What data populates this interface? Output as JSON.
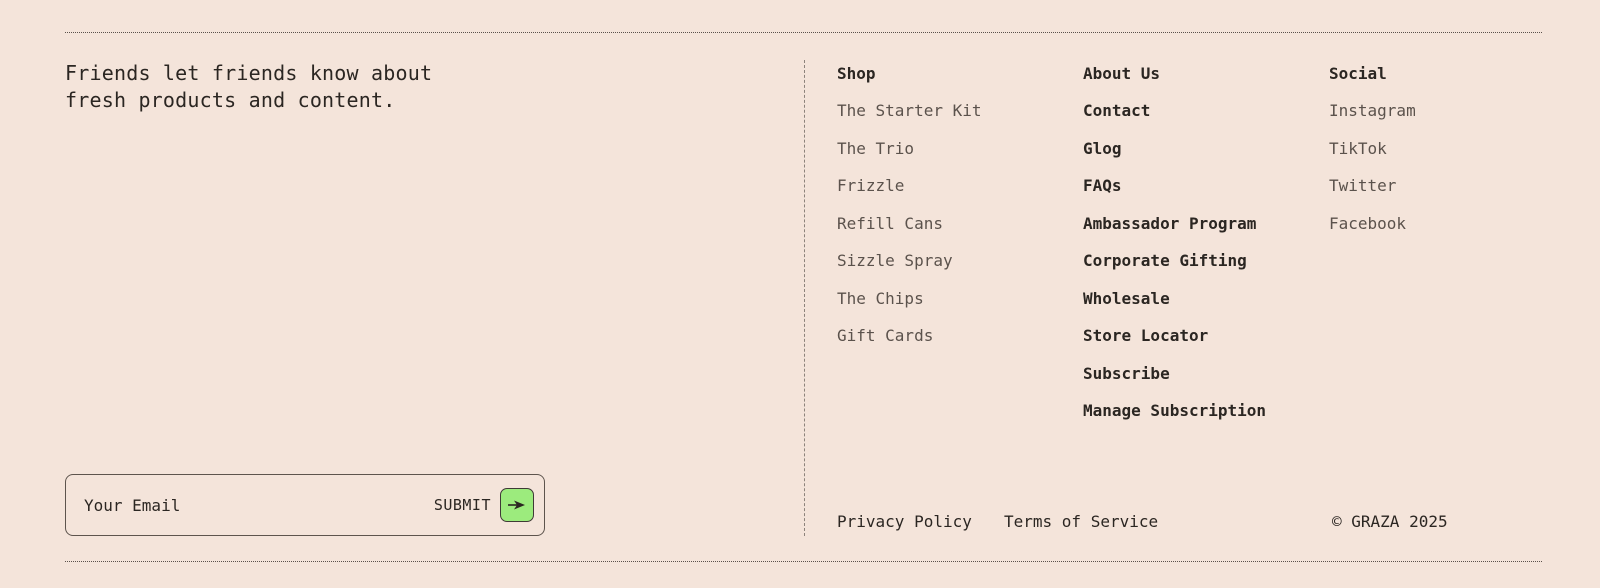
{
  "tagline": {
    "line1": "Friends let friends know about",
    "line2": "fresh products and content."
  },
  "subscribe": {
    "placeholder": "Your Email",
    "submit_label": "SUBMIT",
    "button_color": "#9ceb7d"
  },
  "shop": {
    "heading": "Shop",
    "items": [
      "The Starter Kit",
      "The Trio",
      "Frizzle",
      "Refill Cans",
      "Sizzle Spray",
      "The Chips",
      "Gift Cards"
    ]
  },
  "about": {
    "heading": "About Us",
    "items": [
      "Contact",
      "Glog",
      "FAQs",
      "Ambassador Program",
      "Corporate Gifting",
      "Wholesale",
      "Store Locator",
      "Subscribe",
      "Manage Subscription"
    ]
  },
  "social": {
    "heading": "Social",
    "items": [
      "Instagram",
      "TikTok",
      "Twitter",
      "Facebook"
    ]
  },
  "legal": {
    "privacy": "Privacy Policy",
    "terms": "Terms of Service",
    "copyright": "© GRAZA 2025"
  },
  "colors": {
    "background": "#f4e4da",
    "text": "#2b2622",
    "muted_text": "#5b524c"
  }
}
